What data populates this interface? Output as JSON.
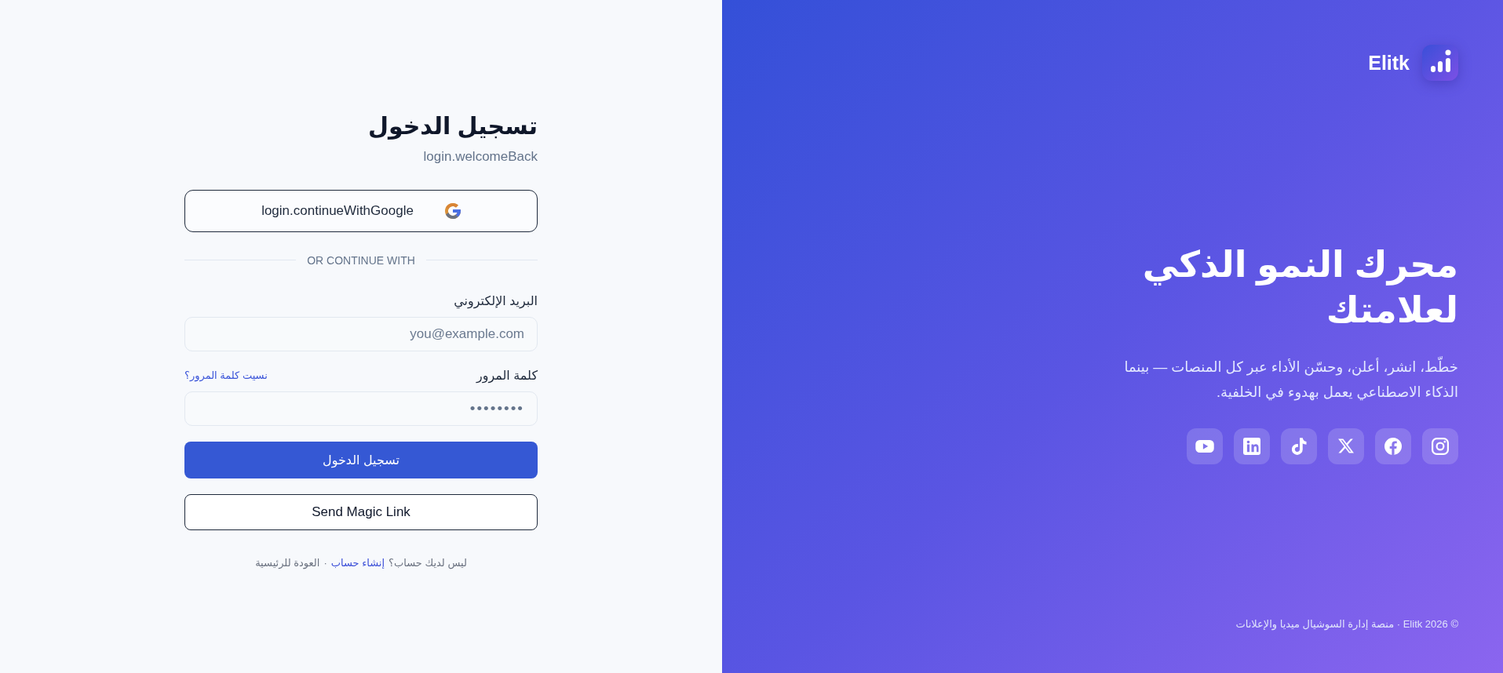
{
  "login": {
    "title": "تسجيل الدخول",
    "subtitle": "login.welcomeBack",
    "google_button": "login.continueWithGoogle",
    "divider": "OR CONTINUE WITH",
    "fields": [
      {
        "kind": "email",
        "label": "البريد الإلكتروني",
        "placeholder": "you@example.com"
      },
      {
        "kind": "password",
        "label": "كلمة المرور",
        "link": "نسيت كلمة المرور؟",
        "value": "••••••••"
      }
    ],
    "buttons": [
      {
        "kind": "primary",
        "label": "تسجيل الدخول"
      },
      {
        "kind": "outline",
        "label": "Send Magic Link"
      }
    ],
    "footer": {
      "prompt": "ليس لديك حساب؟",
      "signup_link": "إنشاء حساب",
      "separator": "·",
      "home_link": "العودة للرئيسية"
    }
  },
  "hero": {
    "brand": "Elitk",
    "headline_lines": [
      "محرك النمو الذكي",
      "لعلامتك"
    ],
    "description": "خطّط، انشر، أعلن، وحسّن الأداء عبر كل المنصات — بينما الذكاء الاصطناعي يعمل بهدوء في الخلفية.",
    "social_links": [
      {
        "kind": "instagram"
      },
      {
        "kind": "facebook"
      },
      {
        "kind": "x"
      },
      {
        "kind": "tiktok"
      },
      {
        "kind": "linkedin"
      },
      {
        "kind": "youtube"
      }
    ],
    "copyright": "© Elitk 2026 · منصة إدارة السوشيال ميديا والإعلانات"
  }
}
